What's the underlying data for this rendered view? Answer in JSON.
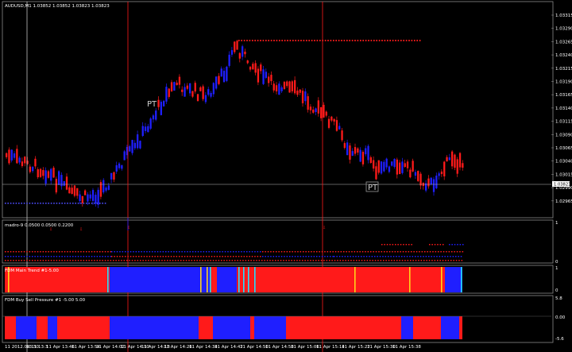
{
  "symbol_header": "AUDUSD,M1  1.03852 1.03852 1.03823 1.03823",
  "price_axis": [
    "1.03315",
    "1.03290",
    "1.03265",
    "1.03240",
    "1.03215",
    "1.03190",
    "1.03165",
    "1.03140",
    "1.03115",
    "1.03090",
    "1.03065",
    "1.03040",
    "1.03015",
    "1.02990",
    "1.02965"
  ],
  "current_price": "1.03823",
  "pt_labels": [
    "PT",
    "PT"
  ],
  "indicators": {
    "madro": {
      "title": "madro-9 0.0500 0.0500 0.2200",
      "axis_top": "1",
      "axis_bottom": "0"
    },
    "trend": {
      "title": "FDM Main Trend #1-5.00",
      "axis_top": "1",
      "axis_bottom": "0"
    },
    "pressure": {
      "title": "FDM Buy Sell Pressure #1 -5.00 5.00",
      "axis_top": "5.8",
      "axis_mid": "0.00",
      "axis_bottom": "-5.6"
    }
  },
  "time_axis": [
    "11 2012.04.11 13:3",
    "13:30",
    "11 Apr 13:46",
    "11 Apr 13:54",
    "11 Apr 14:02",
    "11 Apr 14:10",
    "11 Apr 14:18",
    "11 Apr 14:26",
    "11 Apr 14:34",
    "11 Apr 14:42",
    "11 Apr 14:50",
    "11 Apr 14:58",
    "11 Apr 15:06",
    "11 Apr 15:14",
    "11 Apr 15:22",
    "11 Apr 15:30",
    "11 Apr 15:38"
  ],
  "colors": {
    "bull": "#1f1fff",
    "bear": "#ff1a1a",
    "grid": "#5a5a5a",
    "frame": "#8a8a8a",
    "cyan": "#22e0ff",
    "yellow": "#ffd21a"
  }
}
